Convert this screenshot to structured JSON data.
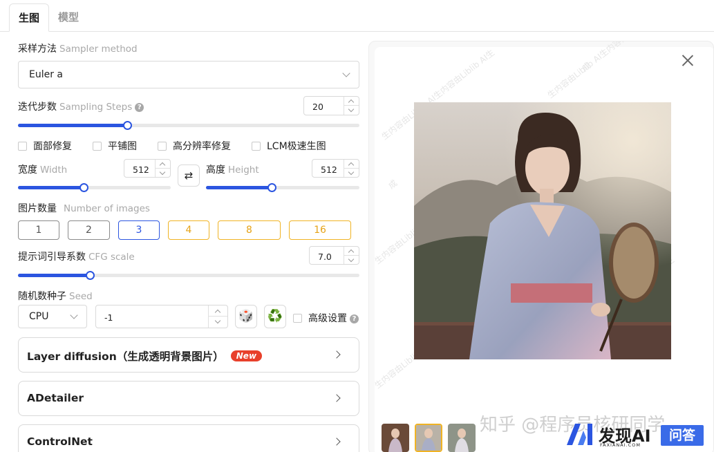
{
  "tabs": {
    "generate": "生图",
    "model": "模型"
  },
  "sampler": {
    "label_cn": "采样方法",
    "label_en": "Sampler method",
    "value": "Euler a"
  },
  "steps": {
    "label_cn": "迭代步数",
    "label_en": "Sampling Steps",
    "help": "?",
    "value": "20",
    "level": 0.32
  },
  "options": {
    "face": "面部修复",
    "tile": "平铺图",
    "hires": "高分辨率修复",
    "lcm": "LCM极速生图"
  },
  "width": {
    "label_cn": "宽度",
    "label_en": "Width",
    "value": "512",
    "level": 0.43
  },
  "height": {
    "label_cn": "高度",
    "label_en": "Height",
    "value": "512",
    "level": 0.43
  },
  "swap_glyph": "⇄",
  "count": {
    "label_cn": "图片数量",
    "label_en": "Number of images",
    "options": [
      "1",
      "2",
      "3",
      "4",
      "8",
      "16"
    ],
    "selected": "3"
  },
  "cfg": {
    "label_cn": "提示词引导系数",
    "label_en": "CFG scale",
    "value": "7.0",
    "level": 0.21
  },
  "seed": {
    "label_cn": "随机数种子",
    "label_en": "Seed",
    "device": "CPU",
    "value": "-1",
    "advanced": "高级设置",
    "help": "?",
    "dice": "🎲",
    "recycle": "♻️"
  },
  "panels": {
    "layer_diffusion_en": "Layer diffusion",
    "layer_diffusion_cn": "（生成透明背景图片）",
    "new_badge": "New",
    "adetailer": "ADetailer",
    "controlnet": "ControlNet"
  },
  "watermark": "生内容由Liblib AI生内容由Liblib AI生",
  "watermark_tail": "成",
  "overlay": {
    "zhihu": "知乎 @程序员核研同学",
    "brand": "发现AI",
    "brand_sub": "FAXIANAI.COM",
    "qa": "问答"
  },
  "colors": {
    "accent": "#2b55e0",
    "gold": "#f0b323",
    "badge": "#e8402b"
  }
}
